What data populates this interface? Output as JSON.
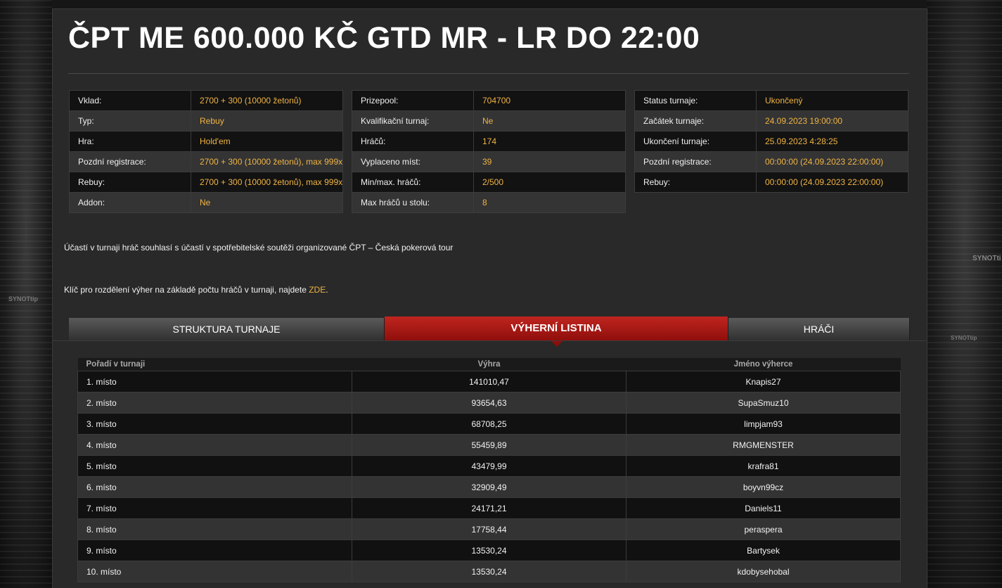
{
  "page": {
    "title": "ČPT ME 600.000 KČ GTD MR - LR DO 22:00",
    "brand_left": "SYNOTtip",
    "brand_right": "SYNOTti",
    "brand_right2": "SYNOTtip"
  },
  "info_tables": [
    [
      {
        "label": "Vklad:",
        "value": "2700 + 300 (10000 žetonů)"
      },
      {
        "label": "Typ:",
        "value": "Rebuy"
      },
      {
        "label": "Hra:",
        "value": "Hold'em"
      },
      {
        "label": "Pozdní registrace:",
        "value": "2700 + 300 (10000 žetonů), max 999x"
      },
      {
        "label": "Rebuy:",
        "value": "2700 + 300 (10000 žetonů), max 999x"
      },
      {
        "label": "Addon:",
        "value": "Ne"
      }
    ],
    [
      {
        "label": "Prizepool:",
        "value": "704700"
      },
      {
        "label": "Kvalifikační turnaj:",
        "value": "Ne"
      },
      {
        "label": "Hráčů:",
        "value": "174"
      },
      {
        "label": "Vyplaceno míst:",
        "value": "39"
      },
      {
        "label": "Min/max. hráčů:",
        "value": "2/500"
      },
      {
        "label": "Max hráčů u stolu:",
        "value": "8"
      }
    ],
    [
      {
        "label": "Status turnaje:",
        "value": "Ukončený"
      },
      {
        "label": "Začátek turnaje:",
        "value": "24.09.2023 19:00:00"
      },
      {
        "label": "Ukončení turnaje:",
        "value": "25.09.2023 4:28:25"
      },
      {
        "label": "Pozdní registrace:",
        "value": "00:00:00 (24.09.2023 22:00:00)"
      },
      {
        "label": "Rebuy:",
        "value": "00:00:00 (24.09.2023 22:00:00)"
      }
    ]
  ],
  "notes": {
    "consent": "Účastí v turnaji hráč souhlasí s účastí v spotřebitelské soutěži organizované ČPT – Česká pokerová tour",
    "payout_key": "Klíč pro rozdělení výher na základě počtu hráčů v turnaji, najdete ",
    "payout_link": "ZDE",
    "payout_end": "."
  },
  "tabs": [
    {
      "label": "STRUKTURA TURNAJE"
    },
    {
      "label": "VÝHERNÍ LISTINA"
    },
    {
      "label": "HRÁČI"
    }
  ],
  "prize_table": {
    "headers": [
      "Pořadí v turnaji",
      "Výhra",
      "Jméno výherce"
    ],
    "rows": [
      [
        "1. místo",
        "141010,47",
        "Knapis27"
      ],
      [
        "2. místo",
        "93654,63",
        "SupaSmuz10"
      ],
      [
        "3. místo",
        "68708,25",
        "limpjam93"
      ],
      [
        "4. místo",
        "55459,89",
        "RMGMENSTER"
      ],
      [
        "5. místo",
        "43479,99",
        "krafra81"
      ],
      [
        "6. místo",
        "32909,49",
        "boyvn99cz"
      ],
      [
        "7. místo",
        "24171,21",
        "Daniels11"
      ],
      [
        "8. místo",
        "17758,44",
        "peraspera"
      ],
      [
        "9. místo",
        "13530,24",
        "Bartysek"
      ],
      [
        "10. místo",
        "13530,24",
        "kdobysehobal"
      ]
    ]
  }
}
